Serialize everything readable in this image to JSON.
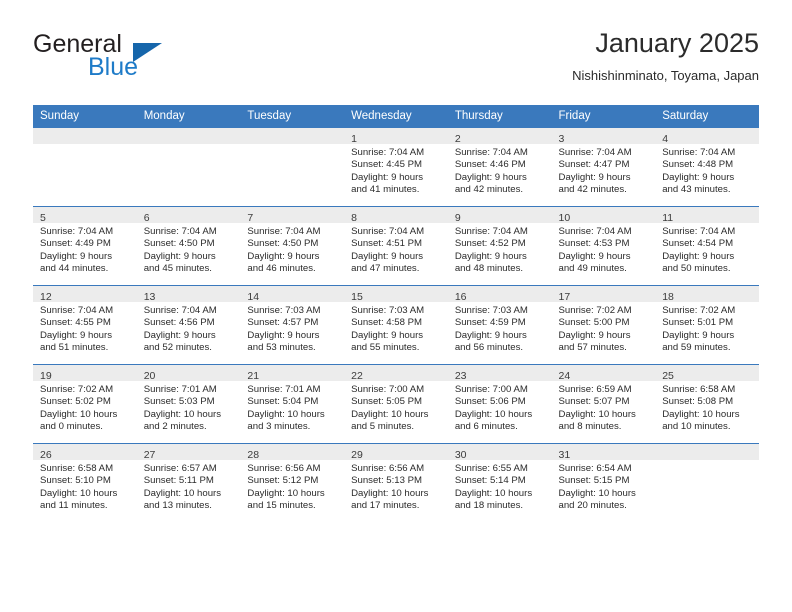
{
  "brand": {
    "line1": "General",
    "line2": "Blue",
    "triangle_icon": "triangle-icon",
    "accent_color": "#1e7bc8",
    "triangle_color": "#1666ab"
  },
  "header": {
    "title": "January 2025",
    "subtitle": "Nishishinminato, Toyama, Japan"
  },
  "theme": {
    "header_band": "#3a79bd",
    "date_strip": "#ececec",
    "grid_line": "#3a79bd",
    "text": "#2b2b2b"
  },
  "weekdays": [
    "Sunday",
    "Monday",
    "Tuesday",
    "Wednesday",
    "Thursday",
    "Friday",
    "Saturday"
  ],
  "weeks": [
    [
      {
        "day": "",
        "empty": true
      },
      {
        "day": "",
        "empty": true
      },
      {
        "day": "",
        "empty": true
      },
      {
        "day": "1",
        "sunrise": "Sunrise: 7:04 AM",
        "sunset": "Sunset: 4:45 PM",
        "daylight1": "Daylight: 9 hours",
        "daylight2": "and 41 minutes."
      },
      {
        "day": "2",
        "sunrise": "Sunrise: 7:04 AM",
        "sunset": "Sunset: 4:46 PM",
        "daylight1": "Daylight: 9 hours",
        "daylight2": "and 42 minutes."
      },
      {
        "day": "3",
        "sunrise": "Sunrise: 7:04 AM",
        "sunset": "Sunset: 4:47 PM",
        "daylight1": "Daylight: 9 hours",
        "daylight2": "and 42 minutes."
      },
      {
        "day": "4",
        "sunrise": "Sunrise: 7:04 AM",
        "sunset": "Sunset: 4:48 PM",
        "daylight1": "Daylight: 9 hours",
        "daylight2": "and 43 minutes."
      }
    ],
    [
      {
        "day": "5",
        "sunrise": "Sunrise: 7:04 AM",
        "sunset": "Sunset: 4:49 PM",
        "daylight1": "Daylight: 9 hours",
        "daylight2": "and 44 minutes."
      },
      {
        "day": "6",
        "sunrise": "Sunrise: 7:04 AM",
        "sunset": "Sunset: 4:50 PM",
        "daylight1": "Daylight: 9 hours",
        "daylight2": "and 45 minutes."
      },
      {
        "day": "7",
        "sunrise": "Sunrise: 7:04 AM",
        "sunset": "Sunset: 4:50 PM",
        "daylight1": "Daylight: 9 hours",
        "daylight2": "and 46 minutes."
      },
      {
        "day": "8",
        "sunrise": "Sunrise: 7:04 AM",
        "sunset": "Sunset: 4:51 PM",
        "daylight1": "Daylight: 9 hours",
        "daylight2": "and 47 minutes."
      },
      {
        "day": "9",
        "sunrise": "Sunrise: 7:04 AM",
        "sunset": "Sunset: 4:52 PM",
        "daylight1": "Daylight: 9 hours",
        "daylight2": "and 48 minutes."
      },
      {
        "day": "10",
        "sunrise": "Sunrise: 7:04 AM",
        "sunset": "Sunset: 4:53 PM",
        "daylight1": "Daylight: 9 hours",
        "daylight2": "and 49 minutes."
      },
      {
        "day": "11",
        "sunrise": "Sunrise: 7:04 AM",
        "sunset": "Sunset: 4:54 PM",
        "daylight1": "Daylight: 9 hours",
        "daylight2": "and 50 minutes."
      }
    ],
    [
      {
        "day": "12",
        "sunrise": "Sunrise: 7:04 AM",
        "sunset": "Sunset: 4:55 PM",
        "daylight1": "Daylight: 9 hours",
        "daylight2": "and 51 minutes."
      },
      {
        "day": "13",
        "sunrise": "Sunrise: 7:04 AM",
        "sunset": "Sunset: 4:56 PM",
        "daylight1": "Daylight: 9 hours",
        "daylight2": "and 52 minutes."
      },
      {
        "day": "14",
        "sunrise": "Sunrise: 7:03 AM",
        "sunset": "Sunset: 4:57 PM",
        "daylight1": "Daylight: 9 hours",
        "daylight2": "and 53 minutes."
      },
      {
        "day": "15",
        "sunrise": "Sunrise: 7:03 AM",
        "sunset": "Sunset: 4:58 PM",
        "daylight1": "Daylight: 9 hours",
        "daylight2": "and 55 minutes."
      },
      {
        "day": "16",
        "sunrise": "Sunrise: 7:03 AM",
        "sunset": "Sunset: 4:59 PM",
        "daylight1": "Daylight: 9 hours",
        "daylight2": "and 56 minutes."
      },
      {
        "day": "17",
        "sunrise": "Sunrise: 7:02 AM",
        "sunset": "Sunset: 5:00 PM",
        "daylight1": "Daylight: 9 hours",
        "daylight2": "and 57 minutes."
      },
      {
        "day": "18",
        "sunrise": "Sunrise: 7:02 AM",
        "sunset": "Sunset: 5:01 PM",
        "daylight1": "Daylight: 9 hours",
        "daylight2": "and 59 minutes."
      }
    ],
    [
      {
        "day": "19",
        "sunrise": "Sunrise: 7:02 AM",
        "sunset": "Sunset: 5:02 PM",
        "daylight1": "Daylight: 10 hours",
        "daylight2": "and 0 minutes."
      },
      {
        "day": "20",
        "sunrise": "Sunrise: 7:01 AM",
        "sunset": "Sunset: 5:03 PM",
        "daylight1": "Daylight: 10 hours",
        "daylight2": "and 2 minutes."
      },
      {
        "day": "21",
        "sunrise": "Sunrise: 7:01 AM",
        "sunset": "Sunset: 5:04 PM",
        "daylight1": "Daylight: 10 hours",
        "daylight2": "and 3 minutes."
      },
      {
        "day": "22",
        "sunrise": "Sunrise: 7:00 AM",
        "sunset": "Sunset: 5:05 PM",
        "daylight1": "Daylight: 10 hours",
        "daylight2": "and 5 minutes."
      },
      {
        "day": "23",
        "sunrise": "Sunrise: 7:00 AM",
        "sunset": "Sunset: 5:06 PM",
        "daylight1": "Daylight: 10 hours",
        "daylight2": "and 6 minutes."
      },
      {
        "day": "24",
        "sunrise": "Sunrise: 6:59 AM",
        "sunset": "Sunset: 5:07 PM",
        "daylight1": "Daylight: 10 hours",
        "daylight2": "and 8 minutes."
      },
      {
        "day": "25",
        "sunrise": "Sunrise: 6:58 AM",
        "sunset": "Sunset: 5:08 PM",
        "daylight1": "Daylight: 10 hours",
        "daylight2": "and 10 minutes."
      }
    ],
    [
      {
        "day": "26",
        "sunrise": "Sunrise: 6:58 AM",
        "sunset": "Sunset: 5:10 PM",
        "daylight1": "Daylight: 10 hours",
        "daylight2": "and 11 minutes."
      },
      {
        "day": "27",
        "sunrise": "Sunrise: 6:57 AM",
        "sunset": "Sunset: 5:11 PM",
        "daylight1": "Daylight: 10 hours",
        "daylight2": "and 13 minutes."
      },
      {
        "day": "28",
        "sunrise": "Sunrise: 6:56 AM",
        "sunset": "Sunset: 5:12 PM",
        "daylight1": "Daylight: 10 hours",
        "daylight2": "and 15 minutes."
      },
      {
        "day": "29",
        "sunrise": "Sunrise: 6:56 AM",
        "sunset": "Sunset: 5:13 PM",
        "daylight1": "Daylight: 10 hours",
        "daylight2": "and 17 minutes."
      },
      {
        "day": "30",
        "sunrise": "Sunrise: 6:55 AM",
        "sunset": "Sunset: 5:14 PM",
        "daylight1": "Daylight: 10 hours",
        "daylight2": "and 18 minutes."
      },
      {
        "day": "31",
        "sunrise": "Sunrise: 6:54 AM",
        "sunset": "Sunset: 5:15 PM",
        "daylight1": "Daylight: 10 hours",
        "daylight2": "and 20 minutes."
      },
      {
        "day": "",
        "empty": true
      }
    ]
  ]
}
